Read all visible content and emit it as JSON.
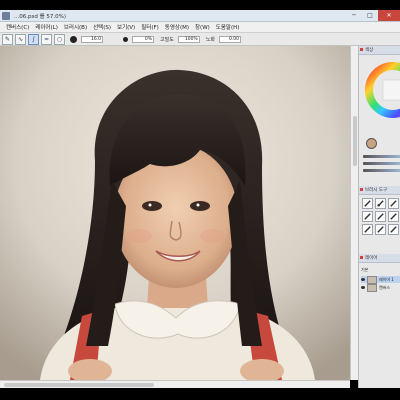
{
  "window": {
    "title": "...06.psd 를 57.0%)",
    "controls": {
      "minimize": "─",
      "maximize": "□",
      "close": "✕"
    }
  },
  "menu": {
    "items": [
      "캔버스(C)",
      "레이어(L)",
      "브러시(B)",
      "선택(S)",
      "보기(V)",
      "필터(F)",
      "동영상(M)",
      "창(W)",
      "도움말(H)"
    ]
  },
  "toolbar": {
    "size_value": "16.0",
    "min_size_value": "0%",
    "density_value": "100%",
    "label_density": "고밀도",
    "label_softness": "노화",
    "softness_value": "0.00"
  },
  "panels": {
    "color": {
      "title": "색상",
      "current_color": "#c9a481",
      "ring_colors": [
        "#ff0000",
        "#ffff00",
        "#00ff00",
        "#00ffff",
        "#0000ff",
        "#ff00ff"
      ]
    },
    "tools": {
      "title": "브러시 도구"
    },
    "layers": {
      "title": "레이어",
      "mode": "기본",
      "items": [
        "레이어 1",
        "캔버스"
      ]
    }
  },
  "colors": {
    "accent_close": "#c9463d",
    "skin": "#e7c2a1",
    "hair": "#2a2220",
    "backpack_strap": "#c7493d",
    "collar": "#f4efe6"
  }
}
